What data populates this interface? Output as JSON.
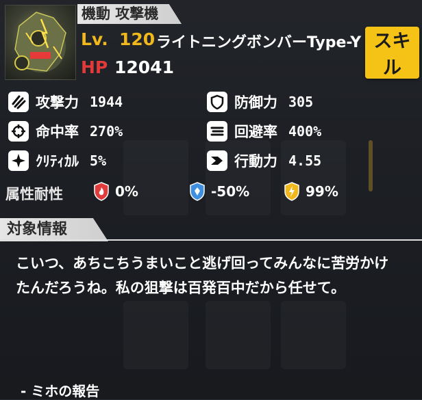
{
  "unit": {
    "class": "機動 攻撃機",
    "level_label": "Lv.",
    "level": "120",
    "name": "ライトニングボンバーType-Y",
    "hp_label": "HP",
    "hp": "12041"
  },
  "skill_button": {
    "label": "スキル"
  },
  "stats": {
    "attack": {
      "label": "攻撃力",
      "value": "1944",
      "icon": "claw-slash-icon"
    },
    "defense": {
      "label": "防御力",
      "value": "305",
      "icon": "shield-icon"
    },
    "accuracy": {
      "label": "命中率",
      "value": "270%",
      "icon": "crosshair-icon"
    },
    "evasion": {
      "label": "回避率",
      "value": "400%",
      "icon": "speed-lines-icon"
    },
    "critical": {
      "label": "ｸﾘﾃｨｶﾙ",
      "value": "5%",
      "icon": "sparkle-icon"
    },
    "action": {
      "label": "行動力",
      "value": "4.55",
      "icon": "chevron-right-icon"
    }
  },
  "resistance": {
    "label": "属性耐性",
    "fire": {
      "value": "0%",
      "color": "#e03c3c",
      "icon": "fire-icon"
    },
    "ice": {
      "value": "-50%",
      "color": "#3f8fe0",
      "icon": "ice-icon"
    },
    "thunder": {
      "value": "99%",
      "color": "#f0b81c",
      "icon": "lightning-icon"
    }
  },
  "target_info": {
    "title": "対象情報",
    "text": "こいつ、あちこちうまいこと逃げ回ってみんなに苦労かけたんだろうね。私の狙撃は百発百中だから任せて。",
    "reporter": "- ミホの報告"
  }
}
